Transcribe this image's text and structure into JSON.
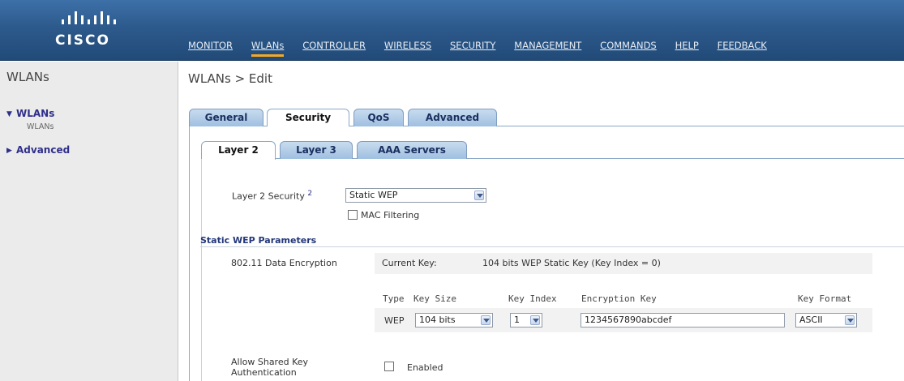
{
  "brand": {
    "logo_text": "CISCO"
  },
  "topnav": [
    {
      "label": "MONITOR"
    },
    {
      "label": "WLANs"
    },
    {
      "label": "CONTROLLER"
    },
    {
      "label": "WIRELESS"
    },
    {
      "label": "SECURITY"
    },
    {
      "label": "MANAGEMENT"
    },
    {
      "label": "COMMANDS"
    },
    {
      "label": "HELP"
    },
    {
      "label": "FEEDBACK"
    }
  ],
  "sidebar": {
    "title": "WLANs",
    "items": [
      {
        "label": "WLANs",
        "sub": "WLANs"
      },
      {
        "label": "Advanced"
      }
    ]
  },
  "page": {
    "title": "WLANs > Edit"
  },
  "tabs": [
    "General",
    "Security",
    "QoS",
    "Advanced"
  ],
  "subtabs": [
    "Layer 2",
    "Layer 3",
    "AAA Servers"
  ],
  "layer2": {
    "security_label": "Layer 2 Security",
    "security_footnote": "2",
    "security_value": "Static WEP",
    "mac_filtering_label": "MAC Filtering"
  },
  "wep": {
    "section_title": "Static WEP Parameters",
    "encryption_label": "802.11 Data Encryption",
    "current_key_label": "Current Key:",
    "current_key_value": "104 bits WEP Static Key (Key Index = 0)",
    "headers": {
      "type": "Type",
      "key_size": "Key Size",
      "key_index": "Key Index",
      "encryption_key": "Encryption Key",
      "key_format": "Key Format"
    },
    "row": {
      "type": "WEP",
      "key_size": "104 bits",
      "key_index": "1",
      "encryption_key": "1234567890abcdef",
      "key_format": "ASCII"
    }
  },
  "shared_key": {
    "label_line1": "Allow Shared Key",
    "label_line2": "Authentication",
    "checkbox_label": "Enabled"
  },
  "colors": {
    "header_blue": "#2d5a8c",
    "nav_active": "#f6a823",
    "sidebar_bg": "#ebebeb",
    "tab_blue": "#9fbfe0",
    "link_blue": "#2f2f8a"
  }
}
